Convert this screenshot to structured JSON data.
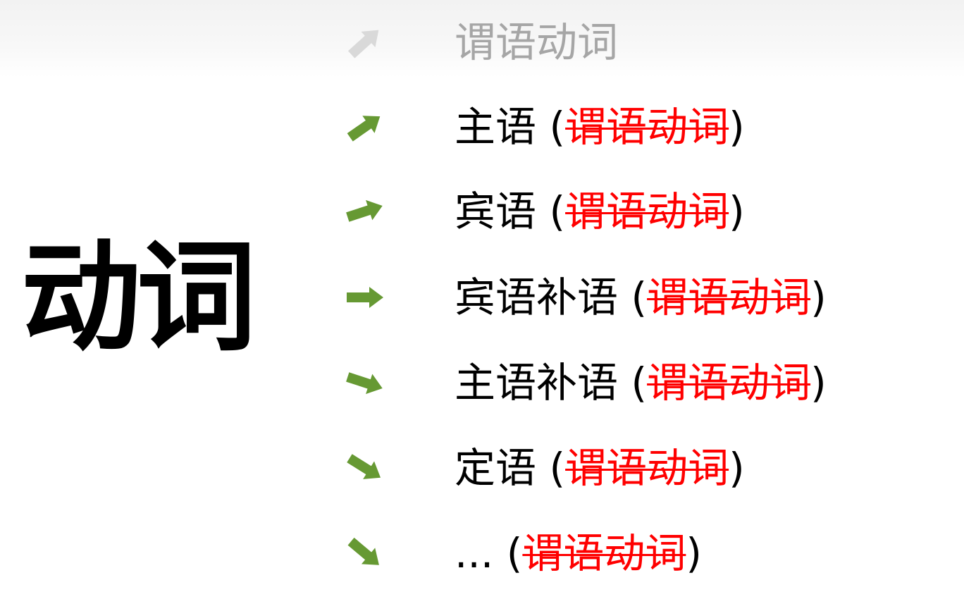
{
  "title": "动词",
  "colors": {
    "arrow": "#669933",
    "arrow_faded": "#d9d9d9",
    "strike": "#ff0000",
    "faded_text": "#a6a6a6"
  },
  "rows": [
    {
      "label": "谓语动词",
      "struck": "",
      "icon": "arrow-up-right-icon",
      "faded": true
    },
    {
      "label": "主语",
      "struck": "谓语动词",
      "open": "(",
      "close": ")",
      "icon": "arrow-up-right-icon"
    },
    {
      "label": "宾语",
      "struck": "谓语动词",
      "open": "(",
      "close": ")",
      "icon": "arrow-slight-up-right-icon"
    },
    {
      "label": "宾语补语",
      "struck": "谓语动词",
      "open": "(",
      "close": ")",
      "icon": "arrow-right-icon"
    },
    {
      "label": "主语补语",
      "struck": "谓语动词",
      "open": "(",
      "close": ")",
      "icon": "arrow-slight-down-right-icon"
    },
    {
      "label": "定语",
      "struck": "谓语动词",
      "open": "(",
      "close": ")",
      "icon": "arrow-down-right-icon"
    },
    {
      "label": "...",
      "struck": "谓语动词",
      "open": "(",
      "close": ")",
      "icon": "arrow-down-right-icon"
    }
  ]
}
